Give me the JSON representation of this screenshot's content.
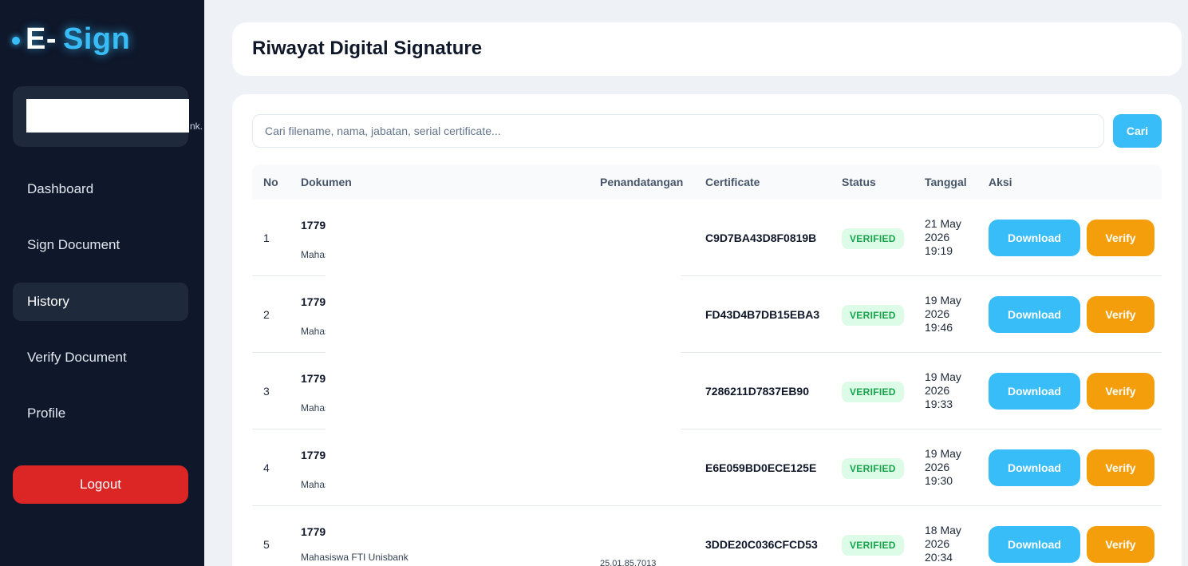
{
  "brand": {
    "prefix": "E-",
    "name": "Sign"
  },
  "user_card": {
    "trailing_text": "nk."
  },
  "sidebar": {
    "items": [
      {
        "label": "Dashboard",
        "active": false
      },
      {
        "label": "Sign Document",
        "active": false
      },
      {
        "label": "History",
        "active": true
      },
      {
        "label": "Verify Document",
        "active": false
      },
      {
        "label": "Profile",
        "active": false
      }
    ],
    "logout_label": "Logout"
  },
  "header": {
    "title": "Riwayat Digital Signature"
  },
  "search": {
    "placeholder": "Cari filename, nama, jabatan, serial certificate...",
    "value": "",
    "button_label": "Cari"
  },
  "table": {
    "columns": [
      "No",
      "Dokumen",
      "Penandatangan",
      "Certificate",
      "Status",
      "Tanggal",
      "Aksi"
    ],
    "rows": [
      {
        "no": "1",
        "doc_title": "1779",
        "doc_sub": "Mahas",
        "certificate": "C9D7BA43D8F0819B",
        "status": "VERIFIED",
        "date": "21 May 2026 19:19",
        "download": "Download",
        "verify": "Verify"
      },
      {
        "no": "2",
        "doc_title": "1779",
        "doc_sub": "Mahas",
        "certificate": "FD43D4B7DB15EBA3",
        "status": "VERIFIED",
        "date": "19 May 2026 19:46",
        "download": "Download",
        "verify": "Verify"
      },
      {
        "no": "3",
        "doc_title": "1779",
        "doc_sub": "Mahas",
        "certificate": "7286211D7837EB90",
        "status": "VERIFIED",
        "date": "19 May 2026 19:33",
        "download": "Download",
        "verify": "Verify"
      },
      {
        "no": "4",
        "doc_title": "1779",
        "doc_sub": "Mahas",
        "certificate": "E6E059BD0ECE125E",
        "status": "VERIFIED",
        "date": "19 May 2026 19:30",
        "download": "Download",
        "verify": "Verify"
      },
      {
        "no": "5",
        "doc_title": "1779",
        "doc_sub": "Mahasiswa FTI Unisbank",
        "signer": "25.01.85.7013",
        "certificate": "3DDE20C036CFCD53",
        "status": "VERIFIED",
        "date": "18 May 2026 20:34",
        "download": "Download",
        "verify": "Verify"
      }
    ]
  },
  "colors": {
    "sidebar_bg": "#0f172a",
    "accent": "#38bdf8",
    "verify": "#f59e0b",
    "logout": "#dc2626",
    "verified_bg": "#dcfce7",
    "verified_text": "#16a34a"
  }
}
